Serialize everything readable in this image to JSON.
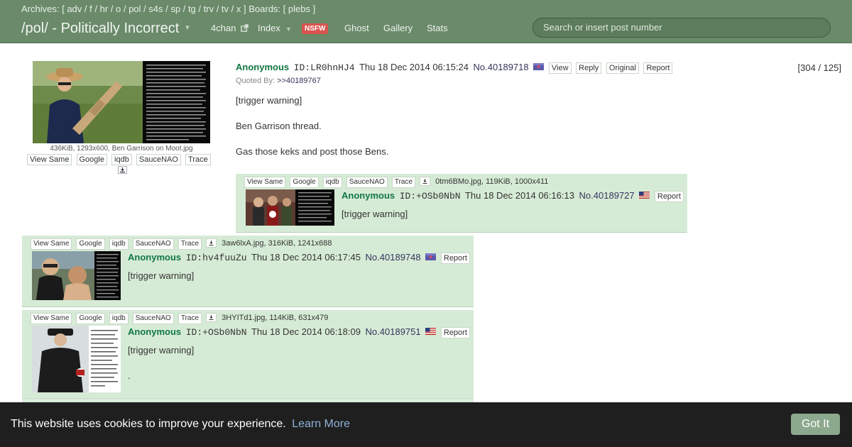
{
  "header": {
    "archives_prefix": "Archives: [",
    "archives": [
      "adv",
      "f",
      "hr",
      "o",
      "pol",
      "s4s",
      "sp",
      "tg",
      "trv",
      "tv",
      "x"
    ],
    "boards_prefix": "] Boards: [",
    "boards": [
      "plebs"
    ],
    "boards_suffix": "]",
    "board_title": "/pol/ - Politically Incorrect",
    "nav_4chan": "4chan",
    "nav_index": "Index",
    "nsfw_badge": "NSFW",
    "nav_ghost": "Ghost",
    "nav_gallery": "Gallery",
    "nav_stats": "Stats",
    "search_placeholder": "Search or insert post number"
  },
  "op": {
    "fileinfo": "436KiB, 1293x600, Ben Garrison on Moot.jpg",
    "file_buttons": [
      "View Same",
      "Google",
      "iqdb",
      "SauceNAO",
      "Trace"
    ],
    "name": "Anonymous",
    "poster_id": "ID:LR0hnHJ4",
    "datetime": "Thu 18 Dec 2014 06:15:24",
    "post_no": "No.40189718",
    "actions": [
      "View",
      "Reply",
      "Original",
      "Report"
    ],
    "quoted_by_label": "Quoted By:",
    "quoted_by_link": ">>40189767",
    "counter": "[304 / 125]",
    "message": [
      "[trigger warning]",
      "Ben Garrison thread.",
      "Gas those keks and post those Bens."
    ]
  },
  "replies": [
    {
      "file_buttons": [
        "View Same",
        "Google",
        "iqdb",
        "SauceNAO",
        "Trace"
      ],
      "fileinfo": "0tm6BMo.jpg, 119KiB, 1000x411",
      "name": "Anonymous",
      "poster_id": "ID:+OSb0NbN",
      "datetime": "Thu 18 Dec 2014 06:16:13",
      "post_no": "No.40189727",
      "report": "Report",
      "message": [
        "[trigger warning]"
      ]
    },
    {
      "file_buttons": [
        "View Same",
        "Google",
        "iqdb",
        "SauceNAO",
        "Trace"
      ],
      "fileinfo": "3aw6lxA.jpg, 316KiB, 1241x688",
      "name": "Anonymous",
      "poster_id": "ID:hv4fuuZu",
      "datetime": "Thu 18 Dec 2014 06:17:45",
      "post_no": "No.40189748",
      "report": "Report",
      "message": [
        "[trigger warning]"
      ]
    },
    {
      "file_buttons": [
        "View Same",
        "Google",
        "iqdb",
        "SauceNAO",
        "Trace"
      ],
      "fileinfo": "3HYITd1.jpg, 114KiB, 631x479",
      "name": "Anonymous",
      "poster_id": "ID:+OSb0NbN",
      "datetime": "Thu 18 Dec 2014 06:18:09",
      "post_no": "No.40189751",
      "report": "Report",
      "message": [
        "[trigger warning]",
        "."
      ]
    }
  ],
  "cookie": {
    "message": "This website uses cookies to improve your experience.",
    "link": "Learn More",
    "button": "Got It"
  },
  "colors": {
    "header_bg": "#6a8a6a",
    "reply_bg": "#d6ebd6",
    "name_green": "#117743",
    "link_blue": "#34345c",
    "nsfw_red": "#d9534f",
    "cookie_bg": "#1f1f1f",
    "cookie_button": "#8da98d"
  }
}
